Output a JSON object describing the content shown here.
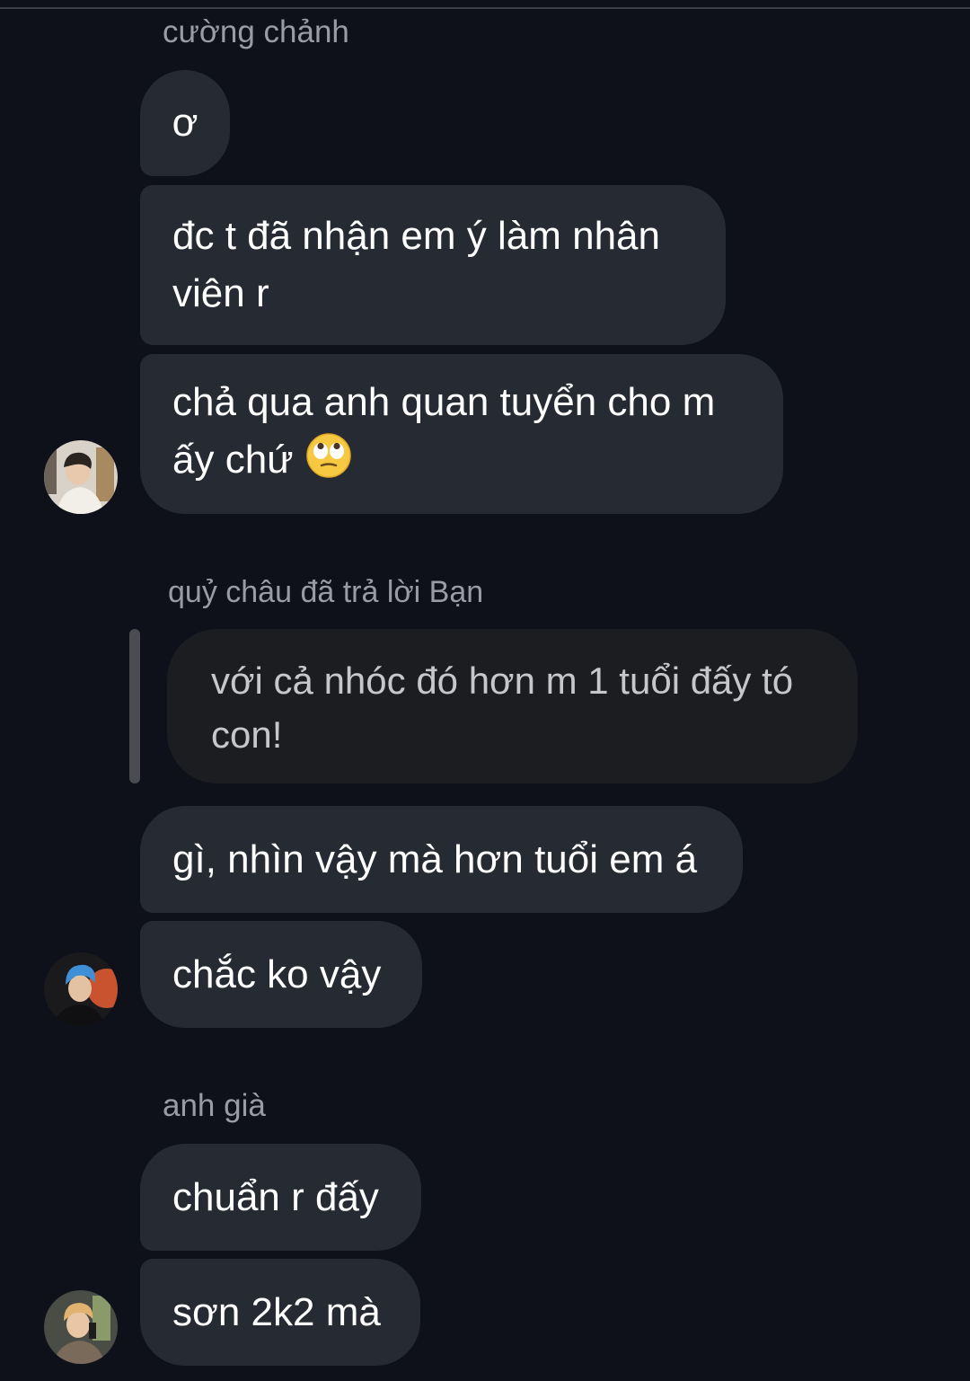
{
  "conversation": {
    "group1": {
      "sender": "cường chảnh",
      "messages": [
        "ơ",
        "đc t đã nhận em ý làm nhân viên r",
        "chả qua anh quan tuyển cho m ấy chứ"
      ],
      "emoji": "face-with-rolling-eyes",
      "avatar": "avatar-cuong-chanh"
    },
    "reply": {
      "header": "quỷ châu đã trả lời Bạn",
      "quoted": "với cả nhóc đó hơn m 1 tuổi đấy tó con!"
    },
    "group2": {
      "messages": [
        "gì, nhìn vậy mà hơn tuổi em á",
        "chắc ko vậy"
      ],
      "avatar": "avatar-quy-chau"
    },
    "group3": {
      "sender": "anh già",
      "messages": [
        "chuẩn r đấy",
        "sơn 2k2 mà"
      ],
      "avatar": "avatar-anh-gia"
    }
  },
  "colors": {
    "background": "#0f111a",
    "bubble": "#262a33",
    "reply_bubble": "#1c1d21",
    "sender_text": "#9a9ca5"
  }
}
